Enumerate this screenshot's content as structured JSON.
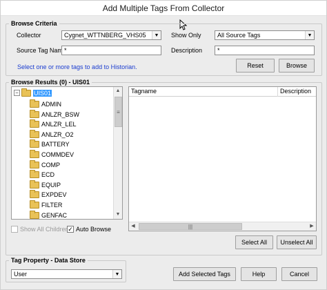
{
  "window": {
    "title": "Add Multiple Tags From Collector"
  },
  "browse_criteria": {
    "legend": "Browse Criteria",
    "collector_label": "Collector",
    "collector_value": "Cygnet_WTTNBERG_VHS05",
    "show_only_label": "Show Only",
    "show_only_value": "All Source Tags",
    "source_tag_name_label": "Source Tag Name",
    "source_tag_name_value": "*",
    "description_label": "Description",
    "description_value": "*",
    "hint": "Select one or more tags to add to Historian.",
    "reset_label": "Reset",
    "browse_label": "Browse"
  },
  "browse_results": {
    "legend": "Browse Results (0) - UIS01",
    "root": "UIS01",
    "items": [
      "ADMIN",
      "ANLZR_BSW",
      "ANLZR_LEL",
      "ANLZR_O2",
      "BATTERY",
      "COMMDEV",
      "COMP",
      "ECD",
      "EQUIP",
      "EXPDEV",
      "FILTER",
      "GENFAC"
    ],
    "columns": [
      "Tagname",
      "Description"
    ],
    "show_all_children_label": "Show All Children",
    "show_all_children_checked": false,
    "auto_browse_label": "Auto Browse",
    "auto_browse_checked": true,
    "select_all_label": "Select All",
    "unselect_all_label": "Unselect All"
  },
  "tag_property": {
    "legend": "Tag Property - Data Store",
    "value": "User"
  },
  "footer": {
    "add_selected_label": "Add Selected Tags",
    "help_label": "Help",
    "cancel_label": "Cancel"
  },
  "icons": {
    "folder": "folder-icon",
    "cursor": "mouse-pointer-icon",
    "dropdown": "chevron-down-icon"
  },
  "colors": {
    "hint_text": "#1a3ccf",
    "selection": "#3399ff",
    "folder": "#e9c257"
  }
}
